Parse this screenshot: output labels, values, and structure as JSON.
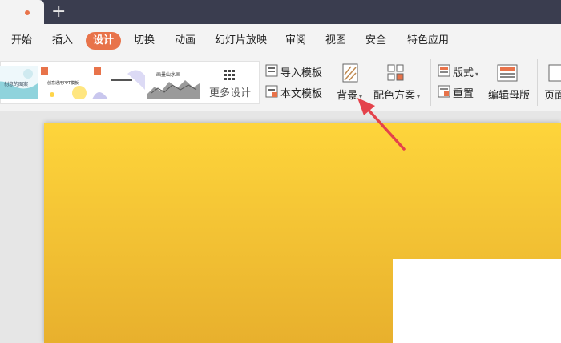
{
  "tabs": {
    "new_tab": "+"
  },
  "menu": [
    "开始",
    "插入",
    "设计",
    "切换",
    "动画",
    "幻灯片放映",
    "审阅",
    "视图",
    "安全",
    "特色应用"
  ],
  "gallery": {
    "more_label": "更多设计",
    "thumbs": [
      "创意的图案",
      "创意通用PPT模板",
      "",
      "画墨山水画"
    ]
  },
  "ribbon": {
    "import_template": "导入模板",
    "text_template": "本文模板",
    "background": "背景",
    "color_scheme": "配色方案",
    "layout": "版式",
    "reset": "重置",
    "edit_master": "编辑母版",
    "page": "页面"
  },
  "colors": {
    "accent": "#e8734a",
    "titlebar": "#3a3d4f",
    "slide_top": "#fed53b",
    "slide_bottom": "#e8b02d",
    "arrow": "#e4424b"
  }
}
